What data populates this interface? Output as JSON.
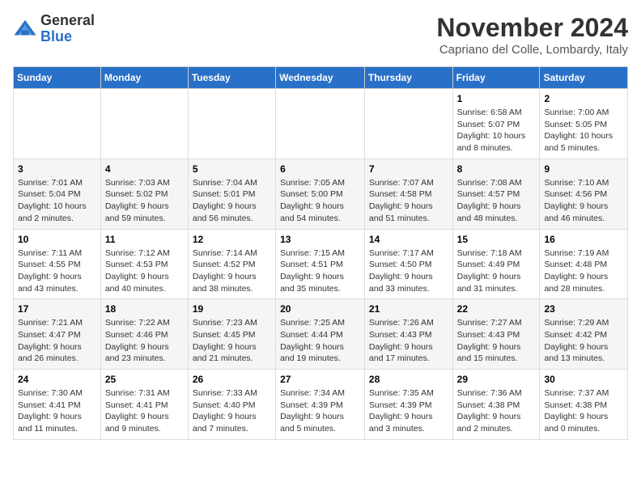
{
  "header": {
    "logo_line1": "General",
    "logo_line2": "Blue",
    "month": "November 2024",
    "location": "Capriano del Colle, Lombardy, Italy"
  },
  "columns": [
    "Sunday",
    "Monday",
    "Tuesday",
    "Wednesday",
    "Thursday",
    "Friday",
    "Saturday"
  ],
  "rows": [
    {
      "alt": false,
      "cells": [
        {
          "day": "",
          "info": ""
        },
        {
          "day": "",
          "info": ""
        },
        {
          "day": "",
          "info": ""
        },
        {
          "day": "",
          "info": ""
        },
        {
          "day": "",
          "info": ""
        },
        {
          "day": "1",
          "info": "Sunrise: 6:58 AM\nSunset: 5:07 PM\nDaylight: 10 hours and 8 minutes."
        },
        {
          "day": "2",
          "info": "Sunrise: 7:00 AM\nSunset: 5:05 PM\nDaylight: 10 hours and 5 minutes."
        }
      ]
    },
    {
      "alt": true,
      "cells": [
        {
          "day": "3",
          "info": "Sunrise: 7:01 AM\nSunset: 5:04 PM\nDaylight: 10 hours and 2 minutes."
        },
        {
          "day": "4",
          "info": "Sunrise: 7:03 AM\nSunset: 5:02 PM\nDaylight: 9 hours and 59 minutes."
        },
        {
          "day": "5",
          "info": "Sunrise: 7:04 AM\nSunset: 5:01 PM\nDaylight: 9 hours and 56 minutes."
        },
        {
          "day": "6",
          "info": "Sunrise: 7:05 AM\nSunset: 5:00 PM\nDaylight: 9 hours and 54 minutes."
        },
        {
          "day": "7",
          "info": "Sunrise: 7:07 AM\nSunset: 4:58 PM\nDaylight: 9 hours and 51 minutes."
        },
        {
          "day": "8",
          "info": "Sunrise: 7:08 AM\nSunset: 4:57 PM\nDaylight: 9 hours and 48 minutes."
        },
        {
          "day": "9",
          "info": "Sunrise: 7:10 AM\nSunset: 4:56 PM\nDaylight: 9 hours and 46 minutes."
        }
      ]
    },
    {
      "alt": false,
      "cells": [
        {
          "day": "10",
          "info": "Sunrise: 7:11 AM\nSunset: 4:55 PM\nDaylight: 9 hours and 43 minutes."
        },
        {
          "day": "11",
          "info": "Sunrise: 7:12 AM\nSunset: 4:53 PM\nDaylight: 9 hours and 40 minutes."
        },
        {
          "day": "12",
          "info": "Sunrise: 7:14 AM\nSunset: 4:52 PM\nDaylight: 9 hours and 38 minutes."
        },
        {
          "day": "13",
          "info": "Sunrise: 7:15 AM\nSunset: 4:51 PM\nDaylight: 9 hours and 35 minutes."
        },
        {
          "day": "14",
          "info": "Sunrise: 7:17 AM\nSunset: 4:50 PM\nDaylight: 9 hours and 33 minutes."
        },
        {
          "day": "15",
          "info": "Sunrise: 7:18 AM\nSunset: 4:49 PM\nDaylight: 9 hours and 31 minutes."
        },
        {
          "day": "16",
          "info": "Sunrise: 7:19 AM\nSunset: 4:48 PM\nDaylight: 9 hours and 28 minutes."
        }
      ]
    },
    {
      "alt": true,
      "cells": [
        {
          "day": "17",
          "info": "Sunrise: 7:21 AM\nSunset: 4:47 PM\nDaylight: 9 hours and 26 minutes."
        },
        {
          "day": "18",
          "info": "Sunrise: 7:22 AM\nSunset: 4:46 PM\nDaylight: 9 hours and 23 minutes."
        },
        {
          "day": "19",
          "info": "Sunrise: 7:23 AM\nSunset: 4:45 PM\nDaylight: 9 hours and 21 minutes."
        },
        {
          "day": "20",
          "info": "Sunrise: 7:25 AM\nSunset: 4:44 PM\nDaylight: 9 hours and 19 minutes."
        },
        {
          "day": "21",
          "info": "Sunrise: 7:26 AM\nSunset: 4:43 PM\nDaylight: 9 hours and 17 minutes."
        },
        {
          "day": "22",
          "info": "Sunrise: 7:27 AM\nSunset: 4:43 PM\nDaylight: 9 hours and 15 minutes."
        },
        {
          "day": "23",
          "info": "Sunrise: 7:29 AM\nSunset: 4:42 PM\nDaylight: 9 hours and 13 minutes."
        }
      ]
    },
    {
      "alt": false,
      "cells": [
        {
          "day": "24",
          "info": "Sunrise: 7:30 AM\nSunset: 4:41 PM\nDaylight: 9 hours and 11 minutes."
        },
        {
          "day": "25",
          "info": "Sunrise: 7:31 AM\nSunset: 4:41 PM\nDaylight: 9 hours and 9 minutes."
        },
        {
          "day": "26",
          "info": "Sunrise: 7:33 AM\nSunset: 4:40 PM\nDaylight: 9 hours and 7 minutes."
        },
        {
          "day": "27",
          "info": "Sunrise: 7:34 AM\nSunset: 4:39 PM\nDaylight: 9 hours and 5 minutes."
        },
        {
          "day": "28",
          "info": "Sunrise: 7:35 AM\nSunset: 4:39 PM\nDaylight: 9 hours and 3 minutes."
        },
        {
          "day": "29",
          "info": "Sunrise: 7:36 AM\nSunset: 4:38 PM\nDaylight: 9 hours and 2 minutes."
        },
        {
          "day": "30",
          "info": "Sunrise: 7:37 AM\nSunset: 4:38 PM\nDaylight: 9 hours and 0 minutes."
        }
      ]
    }
  ]
}
